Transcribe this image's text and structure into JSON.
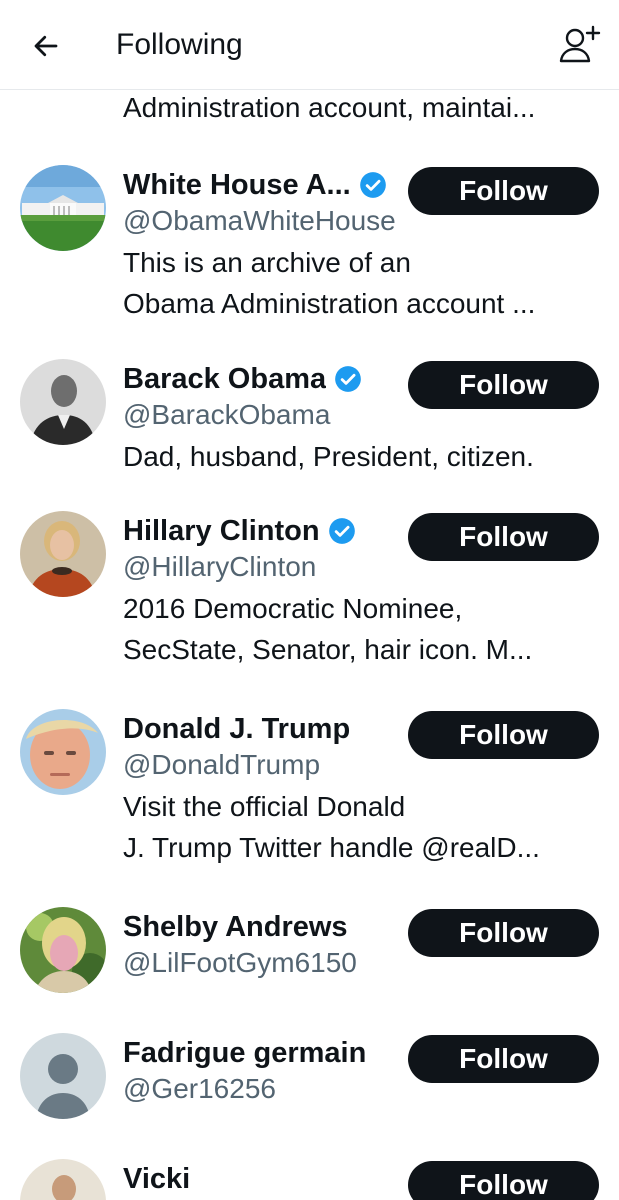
{
  "header": {
    "title": "Following",
    "back_icon": "arrow-left-icon",
    "add_icon": "add-user-icon"
  },
  "partial_bio": "Administration account, maintai...",
  "colors": {
    "follow_button_bg": "#0f1419",
    "verified_badge": "#1d9bf0",
    "handle_text": "#536471"
  },
  "users": [
    {
      "name": "White House A...",
      "verified": true,
      "handle": "@ObamaWhiteHouse",
      "bio": [
        "This is an archive of an",
        "Obama Administration account ..."
      ],
      "follow_label": "Follow",
      "avatar": "white-house-photo"
    },
    {
      "name": "Barack Obama",
      "verified": true,
      "handle": "@BarackObama",
      "bio": [
        "Dad, husband, President, citizen."
      ],
      "follow_label": "Follow",
      "avatar": "portrait-photo"
    },
    {
      "name": "Hillary Clinton",
      "verified": true,
      "handle": "@HillaryClinton",
      "bio": [
        "2016 Democratic Nominee,",
        "SecState, Senator, hair icon. M..."
      ],
      "follow_label": "Follow",
      "avatar": "portrait-photo"
    },
    {
      "name": "Donald J. Trump",
      "verified": false,
      "handle": "@DonaldTrump",
      "bio": [
        "Visit the official Donald",
        "J. Trump Twitter handle @realD..."
      ],
      "follow_label": "Follow",
      "avatar": "portrait-photo"
    },
    {
      "name": "Shelby Andrews",
      "verified": false,
      "handle": "@LilFootGym6150",
      "bio": [],
      "follow_label": "Follow",
      "avatar": "portrait-photo"
    },
    {
      "name": "Fadrigue germain",
      "verified": false,
      "handle": "@Ger16256",
      "bio": [],
      "follow_label": "Follow",
      "avatar": "default-avatar"
    },
    {
      "name": "Vicki",
      "verified": false,
      "handle": "",
      "bio": [],
      "follow_label": "Follow",
      "avatar": "portrait-photo"
    }
  ]
}
